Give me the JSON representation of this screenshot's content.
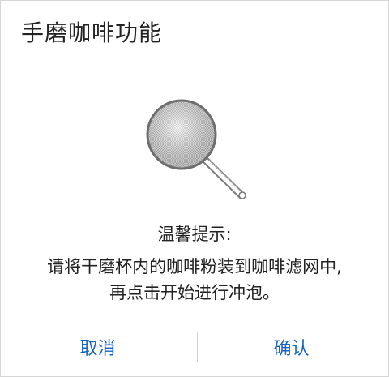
{
  "dialog": {
    "title": "手磨咖啡功能",
    "illustration_icon": "coffee-strainer-icon",
    "tip_heading": "温馨提示:",
    "tip_body_lines": [
      "请将干磨杯内的咖啡粉装到咖啡滤网中,",
      "再点击开始进行冲泡。"
    ],
    "cancel_label": "取消",
    "confirm_label": "确认"
  },
  "colors": {
    "button_text": "#1565c0",
    "text": "#222222",
    "divider": "#d0d0d0",
    "border": "#d6d6d6"
  }
}
